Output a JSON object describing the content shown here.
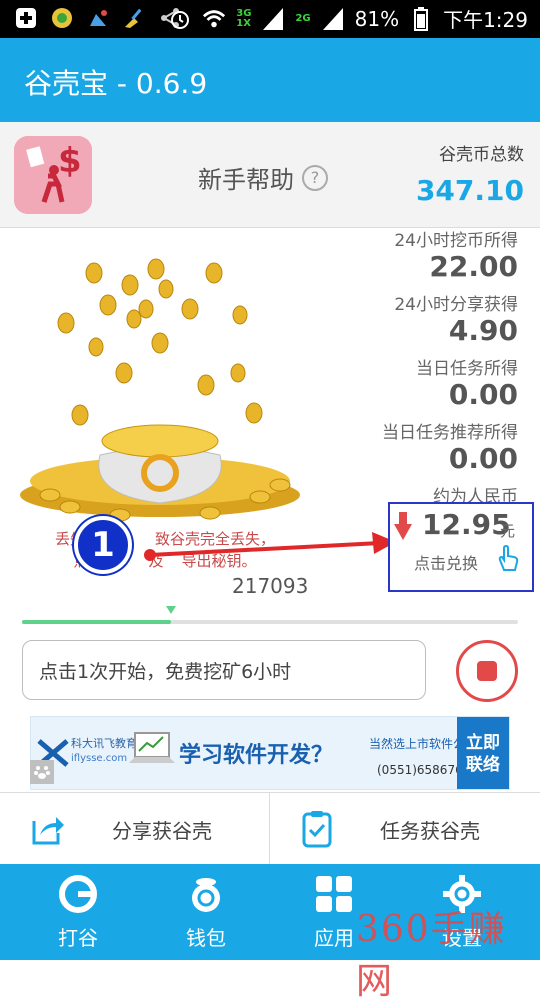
{
  "statusbar": {
    "battery_percent": "81%",
    "time": "下午1:29",
    "net_top": "3G",
    "net_bottom": "1X",
    "net_second": "2G",
    "icons": [
      "add-icon",
      "gift-icon",
      "cleaner-icon",
      "broom-icon",
      "share-icon",
      "alarm-icon",
      "wifi-icon",
      "signal-icon",
      "battery-icon"
    ]
  },
  "appbar": {
    "title": "谷壳宝 - 0.6.9"
  },
  "header": {
    "help_title": "新手帮助",
    "help_icon": "?",
    "total_label": "谷壳币总数",
    "total_value": "347.10"
  },
  "stats": [
    {
      "label": "24小时挖币所得",
      "value": "22.00"
    },
    {
      "label": "24小时分享获得",
      "value": "4.90"
    },
    {
      "label": "当日任务所得",
      "value": "0.00"
    },
    {
      "label": "当日任务推荐所得",
      "value": "0.00"
    }
  ],
  "rmb": {
    "label": "约为人民币",
    "value": "12.95",
    "unit": "元",
    "hint": "点击兑换"
  },
  "warning": {
    "line1": "丢失",
    "line1_tail": "致谷壳完全丢失，",
    "line2_a": "点",
    "line2_b": "及",
    "line2_c": "导出秘钥。"
  },
  "user_id": "217093",
  "annotation": {
    "number": "1"
  },
  "progress": {
    "fraction": 0.3
  },
  "start": {
    "placeholder": "点击1次开始，免费挖矿6小时"
  },
  "banner": {
    "brand": "科大讯飞教育",
    "site": "iflysse.com",
    "headline": "学习软件开发？",
    "tag": "当然选上市软件公司",
    "phone": "(0551)65867693",
    "cta_line1": "立即",
    "cta_line2": "联络"
  },
  "actions": [
    {
      "label": "分享获谷壳",
      "icon": "share-box-icon"
    },
    {
      "label": "任务获谷壳",
      "icon": "clipboard-check-icon"
    }
  ],
  "nav": [
    {
      "label": "打谷",
      "icon": "gukey-logo-icon"
    },
    {
      "label": "钱包",
      "icon": "wallet-icon"
    },
    {
      "label": "应用",
      "icon": "apps-grid-icon"
    },
    {
      "label": "设置",
      "icon": "settings-icon"
    }
  ],
  "watermark": "360手赚网",
  "colors": {
    "primary": "#1aa7e6",
    "accent_red": "#e24a4a",
    "progress": "#5fd18a",
    "annotation_blue": "#1030c8"
  }
}
